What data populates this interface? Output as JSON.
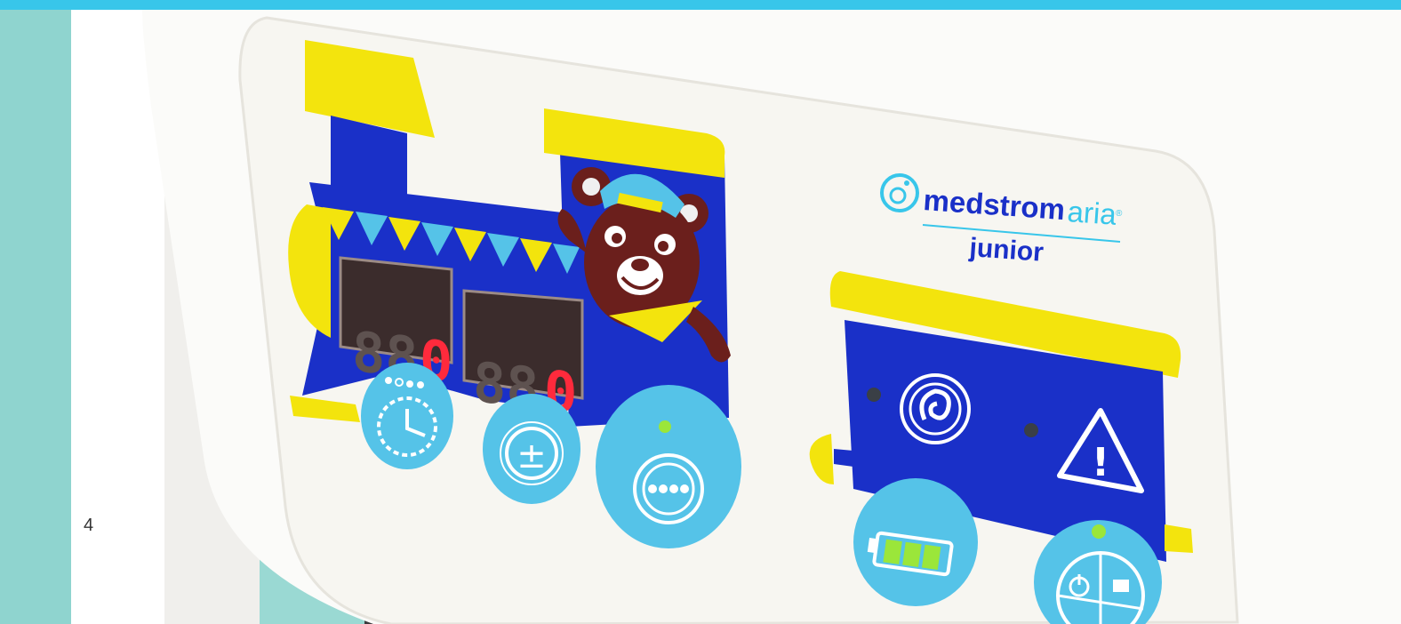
{
  "top_bar": {
    "color": "#38c6ea"
  },
  "page_number": "4",
  "brand": {
    "name": "medstrom",
    "product": "aria",
    "registered_mark": "®",
    "subtitle": "junior"
  },
  "displays": [
    {
      "ghost": "88",
      "lit_digit": "0"
    },
    {
      "ghost": "88",
      "lit_digit": "0"
    }
  ],
  "buttons": {
    "timer": {
      "icon": "timer-icon"
    },
    "adjust": {
      "icon": "plus-minus-icon",
      "glyph": "±"
    },
    "mode": {
      "icon": "dots-icon"
    },
    "pump": {
      "icon": "swirl-icon"
    },
    "alarm": {
      "icon": "warning-icon",
      "glyph": "!"
    },
    "battery": {
      "icon": "battery-icon"
    },
    "power": {
      "icon": "power-lock-icon"
    }
  },
  "colors": {
    "panel": "#f7f6f1",
    "train_blue": "#1a30c8",
    "train_yellow": "#f3e40d",
    "button_cyan": "#55c3e8",
    "led_red": "#ff2a3c",
    "led_green": "#9be63a",
    "bear_brown": "#6b1f1c",
    "frame_teal": "#94d9d3"
  }
}
